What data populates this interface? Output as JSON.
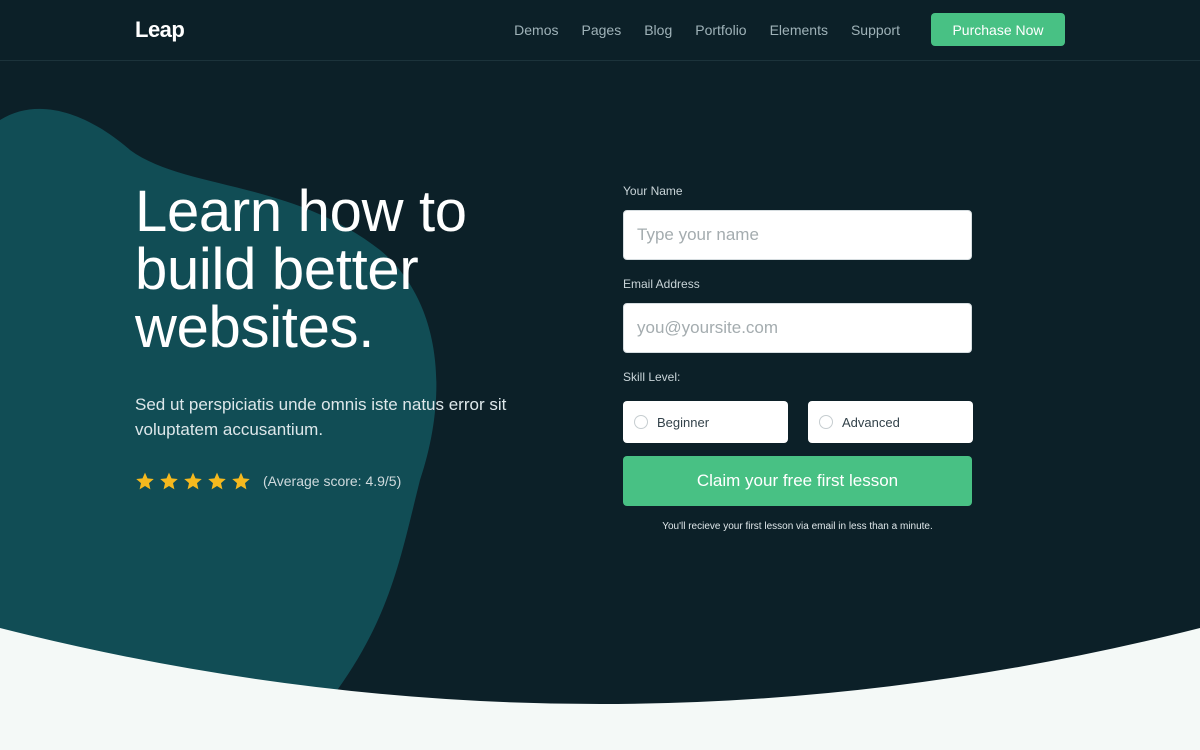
{
  "colors": {
    "background": "#0c2028",
    "blob": "#114d55",
    "accent": "#48c184",
    "footer": "#f4f9f7",
    "star": "#f5b91e"
  },
  "header": {
    "logo": "Leap",
    "nav": [
      "Demos",
      "Pages",
      "Blog",
      "Portfolio",
      "Elements",
      "Support"
    ],
    "cta": "Purchase Now"
  },
  "hero": {
    "headline": "Learn how to build better websites.",
    "subtitle": "Sed ut perspiciatis unde omnis iste natus error sit voluptatem accusantium.",
    "rating": {
      "stars": 5,
      "score_text": "(Average score: 4.9/5)"
    }
  },
  "form": {
    "name_label": "Your Name",
    "name_placeholder": "Type your name",
    "email_label": "Email Address",
    "email_placeholder": "you@yoursite.com",
    "skill_label": "Skill Level:",
    "options": [
      "Beginner",
      "Advanced"
    ],
    "submit": "Claim your free first lesson",
    "note": "You'll recieve your first lesson via email in less than a minute."
  }
}
